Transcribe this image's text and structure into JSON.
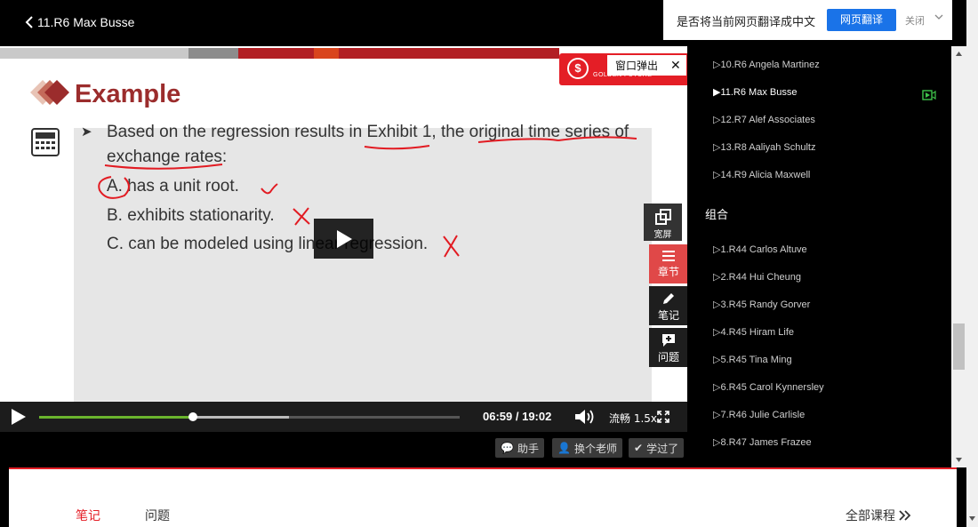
{
  "header": {
    "back_title": "11.R6 Max Busse"
  },
  "translate_bar": {
    "question": "是否将当前网页翻译成中文",
    "translate_button": "网页翻译",
    "close_label": "关闭"
  },
  "video": {
    "popout_label": "窗口弹出",
    "brand_char": "金",
    "brand_sub": "GOLDEN FUTURE",
    "slide_title": "Example",
    "question_line1": "Based on the regression results in Exhibit 1, the original time series of",
    "question_line2": "exchange rates:",
    "option_a": "A.  has a unit root.",
    "option_b": "B.   exhibits stationarity.",
    "option_c": "C.   can be modeled using linear regression.",
    "progress_played": 0.366,
    "progress_buffered": 0.595
  },
  "side_tools": {
    "widescreen": "宽屏",
    "chapters": "章节",
    "notes": "笔记",
    "questions": "问题"
  },
  "controls": {
    "time": "06:59 /  19:02",
    "speed": "流畅 1.5x"
  },
  "actions": {
    "assistant": "助手",
    "change_teacher": "换个老师",
    "learned": "学过了"
  },
  "sidebar": {
    "items_top": [
      "▷10.R6 Angela Martinez",
      "▶11.R6 Max Busse",
      "▷12.R7 Alef Associates",
      "▷13.R8 Aaliyah Schultz",
      "▷14.R9 Alicia Maxwell"
    ],
    "group_label": "组合",
    "items_group": [
      "▷1.R44 Carlos Altuve",
      "▷2.R44 Hui Cheung",
      "▷3.R45 Randy Gorver",
      "▷4.R45 Hiram Life",
      "▷5.R45 Tina Ming",
      "▷6.R45 Carol Kynnersley",
      "▷7.R46 Julie Carlisle",
      "▷8.R47 James Frazee"
    ]
  },
  "bottom_tabs": {
    "notes": "笔记",
    "questions": "问题",
    "all_courses": "全部课程"
  },
  "colors": {
    "accent_red": "#e41e26",
    "progress_green": "#6ab42d",
    "title_red": "#9b2c2c",
    "translate_blue": "#1a73e8"
  }
}
